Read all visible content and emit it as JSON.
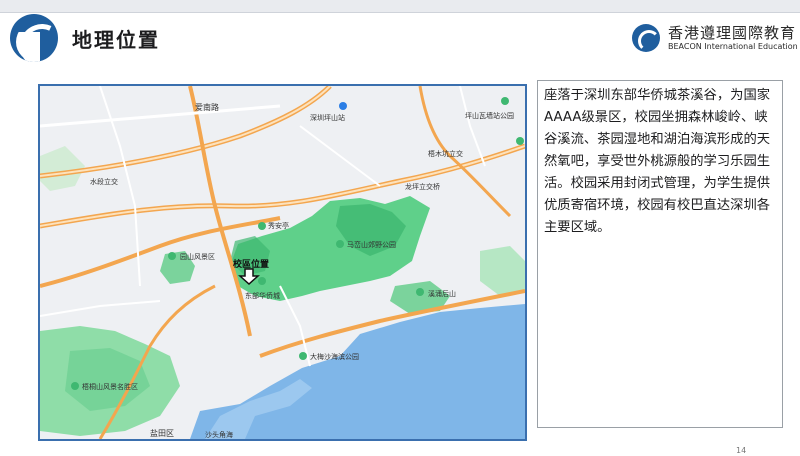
{
  "header": {
    "title": "地理位置",
    "brand_cn": "香港遵理國際教育",
    "brand_en": "BEACON International Education"
  },
  "map": {
    "labels": {
      "aihu_road": "爱南路",
      "shenzhen_pingshan": "深圳坪山站",
      "pingshan_station": "坪山瓦墙站公园",
      "xinmu_bridge": "梧木坑立交",
      "shuijing_bridge": "水段立交",
      "longping_bridge": "龙坪立交桥",
      "xiuan_bridge": "秀安亭",
      "yuanshan_scenic": "园山风景区",
      "campus_location": "校區位置",
      "donghua_ocean": "东部华侨城",
      "malanshan_park": "马峦山郊野公园",
      "xisha_houshan": "溪涌后山",
      "dameisha_park": "大梅沙海滨公园",
      "wutongshan_scenic": "梧桐山风景名胜区",
      "yantian_district": "盐田区",
      "shatou_corner": "沙头角海"
    }
  },
  "description": "座落于深圳东部华侨城茶溪谷，为国家AAAA级景区，校园坐拥森林峻岭、峡谷溪流、茶园湿地和湖泊海滨形成的天然氧吧，享受世外桃源般的学习乐园生活。校园采用封闭式管理，为学生提供优质寄宿环境，校园有校巴直达深圳各主要区域。",
  "page_number": "14",
  "colors": {
    "brand_blue": "#1f5e9e",
    "map_border": "#3a6fae",
    "green_area": "#5fd08a",
    "sea": "#7fb6e8",
    "road": "#f3a64f"
  }
}
